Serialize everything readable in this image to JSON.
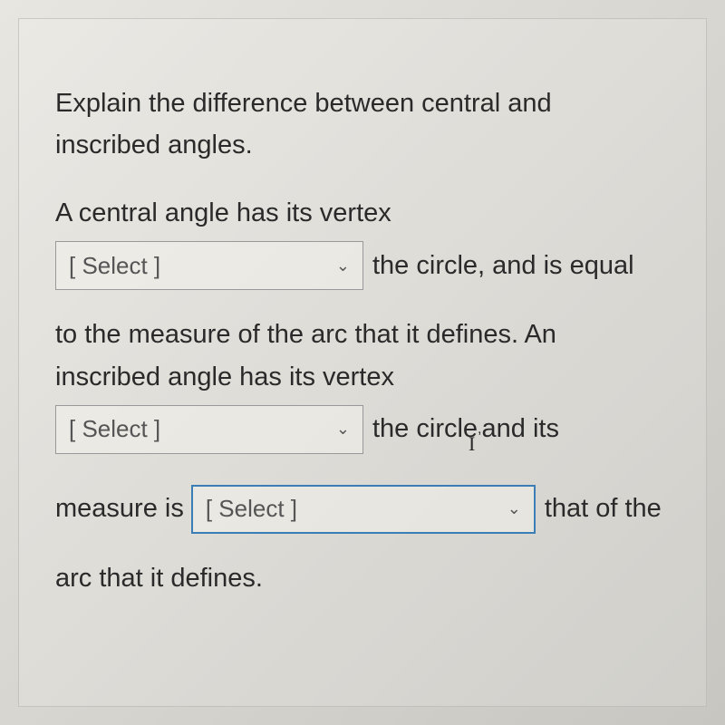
{
  "question": {
    "prompt_line1": "Explain the difference between central and",
    "prompt_line2": "inscribed angles.",
    "text_part1": "A central angle has its vertex",
    "text_after_select1": " the circle, and is equal",
    "text_part2a": "to the measure of the arc that it defines. An",
    "text_part2b": "inscribed angle has its vertex",
    "text_after_select2_a": " the circle",
    "text_after_select2_b": " and its",
    "text_before_select3": "measure is ",
    "text_after_select3": " that of the",
    "text_final": "arc that it defines."
  },
  "selects": {
    "select1_placeholder": "[ Select ]",
    "select2_placeholder": "[ Select ]",
    "select3_placeholder": "[ Select ]"
  },
  "punctuation": {
    "comma": ","
  }
}
